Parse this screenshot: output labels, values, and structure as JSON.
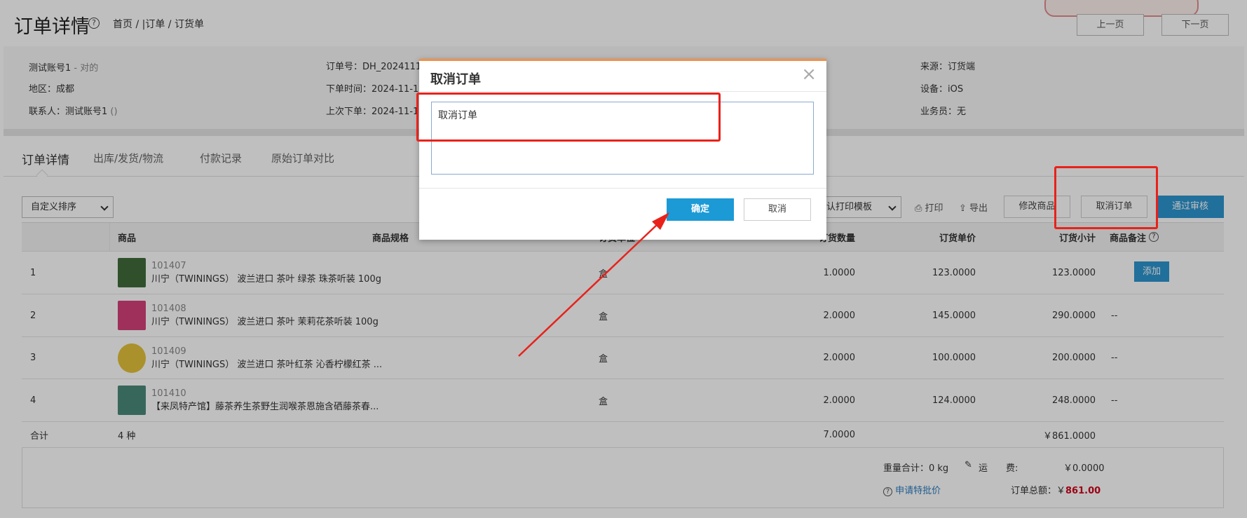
{
  "header": {
    "title": "订单详情",
    "breadcrumb": "首页 / |订单 / 订货单",
    "prev_label": "上一页",
    "next_label": "下一页"
  },
  "info": {
    "account": "测试账号1",
    "account_suffix": "- 对的",
    "region": "地区：成都",
    "contact": "联系人：测试账号1",
    "contact_suffix": "()",
    "order_no": "订单号：DH_2024111",
    "order_time": "下单时间：2024-11-1",
    "last_order": "上次下单：2024-11-1",
    "source": "来源：订货端",
    "device": "设备：iOS",
    "salesman": "业务员：无"
  },
  "tabs": [
    "订单详情",
    "出库/发货/物流",
    "付款记录",
    "原始订单对比"
  ],
  "toolbar": {
    "sort_select": "自定义排序",
    "print_template_select": "认打印模板",
    "print_label": "打印",
    "export_label": "导出",
    "modify_label": "修改商品",
    "cancel_order_label": "取消订单",
    "approve_label": "通过审核"
  },
  "table": {
    "headers": {
      "product": "商品",
      "spec": "商品规格",
      "unit": "订货单位",
      "qty": "订货数量",
      "price": "订货单价",
      "subtotal": "订货小计",
      "remark": "商品备注"
    },
    "rows": [
      {
        "index": "1",
        "code": "101407",
        "name": "川宁（TWININGS） 波兰进口 茶叶 绿茶 珠茶听装 100g",
        "unit": "盒",
        "qty": "1.0000",
        "price": "123.0000",
        "subtotal": "123.0000",
        "remark": "",
        "thumb_color": "#3f6b3a"
      },
      {
        "index": "2",
        "code": "101408",
        "name": "川宁（TWININGS） 波兰进口 茶叶 茉莉花茶听装 100g",
        "unit": "盒",
        "qty": "2.0000",
        "price": "145.0000",
        "subtotal": "290.0000",
        "remark": "--",
        "thumb_color": "#d3407a"
      },
      {
        "index": "3",
        "code": "101409",
        "name": "川宁（TWININGS） 波兰进口 茶叶红茶 沁香柠檬红茶 ...",
        "unit": "盒",
        "qty": "2.0000",
        "price": "100.0000",
        "subtotal": "200.0000",
        "remark": "--",
        "thumb_color": "#e3c23a"
      },
      {
        "index": "4",
        "code": "101410",
        "name": "【来凤特产馆】藤茶养生茶野生润喉茶恩施含硒藤茶春...",
        "unit": "盒",
        "qty": "2.0000",
        "price": "124.0000",
        "subtotal": "248.0000",
        "remark": "--",
        "thumb_color": "#4a8a7a"
      }
    ],
    "add_label": "添加",
    "total_label": "合计",
    "total_kinds": "4 种",
    "total_qty": "7.0000",
    "total_amount": "￥861.0000"
  },
  "summary": {
    "weight": "重量合计：0 kg",
    "freight_label": "运　　费:",
    "freight_value": "￥0.0000",
    "special_price_link": "申请特批价",
    "order_total_label": "订单总额：￥",
    "order_total_value": "861.00"
  },
  "modal": {
    "title": "取消订单",
    "close": "×",
    "textarea_value": "取消订单",
    "ok_label": "确定",
    "cancel_label": "取消"
  },
  "colors": {
    "primary": "#2c95cf",
    "modal_ok": "#1c9ad6",
    "annotation": "#e8221b",
    "total_red": "#d0021b"
  }
}
